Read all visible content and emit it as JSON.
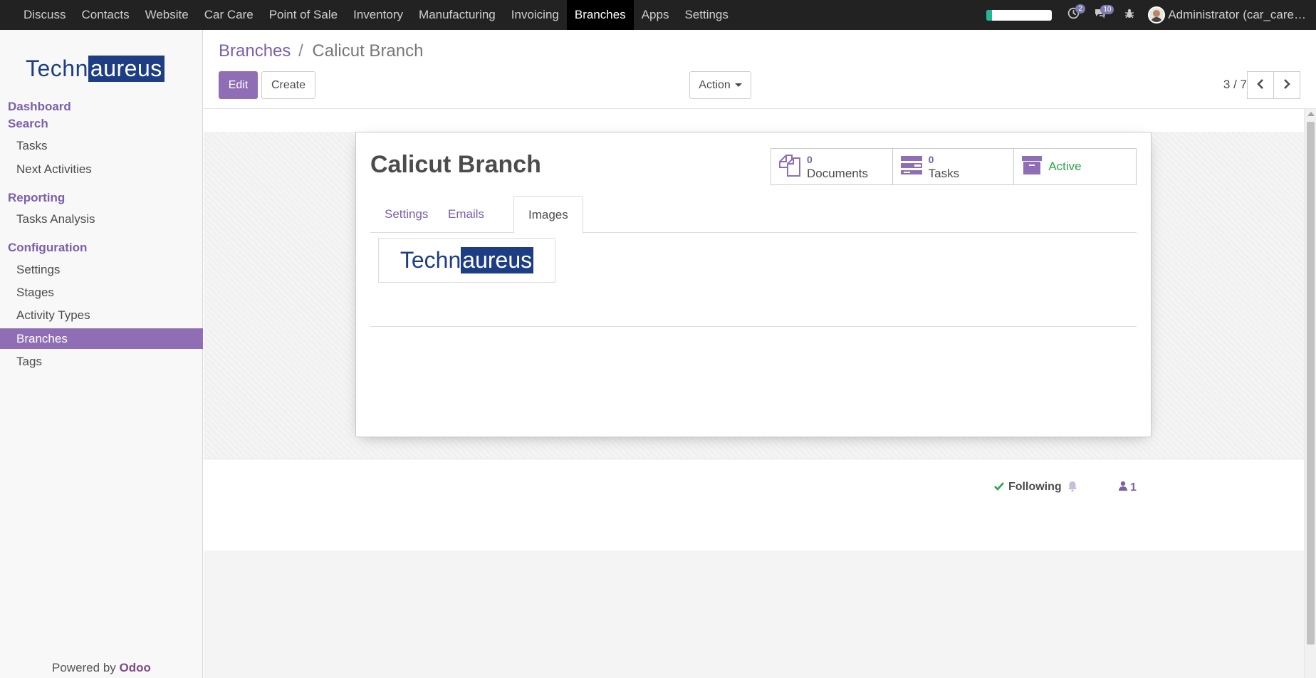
{
  "navbar": {
    "menu": [
      "Discuss",
      "Contacts",
      "Website",
      "Car Care",
      "Point of Sale",
      "Inventory",
      "Manufacturing",
      "Invoicing",
      "Branches",
      "Apps",
      "Settings"
    ],
    "active_menu": "Branches",
    "activity_count": "2",
    "message_count": "10",
    "user_label": "Administrator (car_care…",
    "progress_fraction": 0.08
  },
  "sidebar": {
    "logo_left": "Techn",
    "logo_right": "aureus",
    "sections": {
      "dashboard": "Dashboard",
      "search": "Search",
      "reporting": "Reporting",
      "configuration": "Configuration"
    },
    "items": {
      "tasks": "Tasks",
      "next_activities": "Next Activities",
      "tasks_analysis": "Tasks Analysis",
      "settings": "Settings",
      "stages": "Stages",
      "activity_types": "Activity Types",
      "branches": "Branches",
      "tags": "Tags"
    },
    "powered_prefix": "Powered by ",
    "powered_brand": "Odoo"
  },
  "control_panel": {
    "breadcrumb_parent": "Branches",
    "breadcrumb_sep": "/",
    "breadcrumb_current": "Calicut Branch",
    "edit_label": "Edit",
    "create_label": "Create",
    "action_label": "Action",
    "pager": "3 / 7"
  },
  "record": {
    "title": "Calicut Branch",
    "stats": {
      "documents_count": "0",
      "documents_label": "Documents",
      "tasks_count": "0",
      "tasks_label": "Tasks",
      "active_label": "Active"
    },
    "tabs": [
      "Settings",
      "Emails",
      "Images"
    ],
    "active_tab": "Images",
    "image_left": "Techn",
    "image_right": "aureus"
  },
  "chatter": {
    "following_label": "Following",
    "followers_count": "1"
  },
  "colors": {
    "brand": "#8f6eb5",
    "navbar": "#222222",
    "active_status": "#28a745"
  }
}
